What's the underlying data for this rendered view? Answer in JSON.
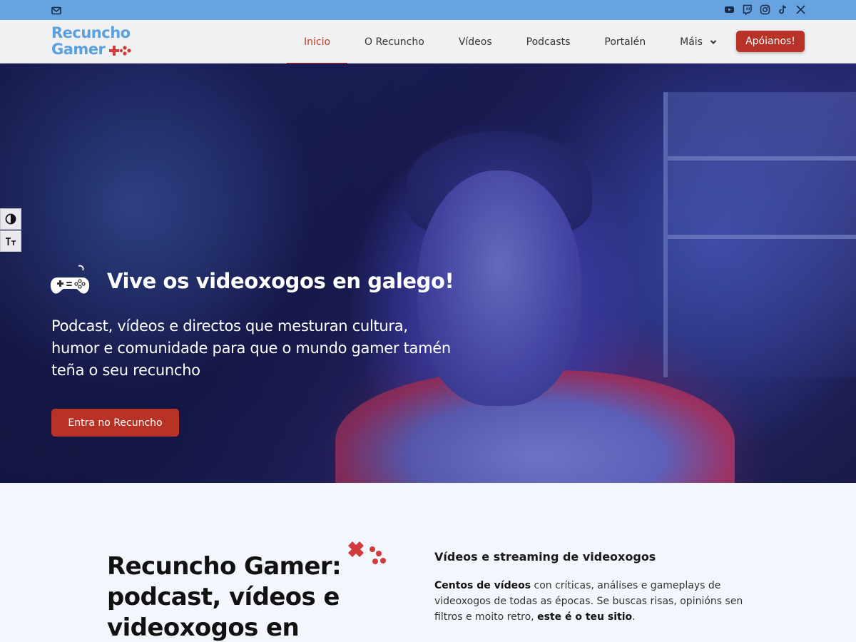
{
  "topbar": {
    "mail_icon": "envelope-icon",
    "social_icons": [
      "youtube-icon",
      "twitch-icon",
      "instagram-icon",
      "tiktok-icon",
      "x-icon"
    ]
  },
  "header": {
    "logo_line1": "Recuncho",
    "logo_line2": "Gamer",
    "nav": [
      {
        "label": "Inicio",
        "active": true
      },
      {
        "label": "O Recuncho",
        "active": false
      },
      {
        "label": "Vídeos",
        "active": false
      },
      {
        "label": "Podcasts",
        "active": false
      },
      {
        "label": "Portalén",
        "active": false
      },
      {
        "label": "Máis",
        "active": false
      }
    ],
    "support_label": "Apóianos!"
  },
  "accessibility": {
    "contrast_icon": "contrast-icon",
    "font_size_icon": "font-size-icon"
  },
  "hero": {
    "title": "Vive os videoxogos en galego!",
    "subtitle": "Podcast, vídeos e directos que mesturan cultura, humor e comunidade para que o mundo gamer tamén teña o seu recuncho",
    "button_label": "Entra no Recuncho"
  },
  "about": {
    "title": "Recuncho Gamer: podcast, vídeos e videoxogos en galego",
    "side_title": "Vídeos e streaming de videoxogos",
    "side_text_bold1": "Centos de vídeos",
    "side_text_mid": " con críticas, análises e gameplays de videoxogos de todas as épocas. Se buscas risas, opinións sen filtros e moito retro, ",
    "side_text_bold2": "este é o teu sitio",
    "side_text_end": "."
  },
  "colors": {
    "accent_red": "#b83226",
    "topbar_blue": "#66a3e0",
    "logo_blue": "#5b9fdd"
  }
}
